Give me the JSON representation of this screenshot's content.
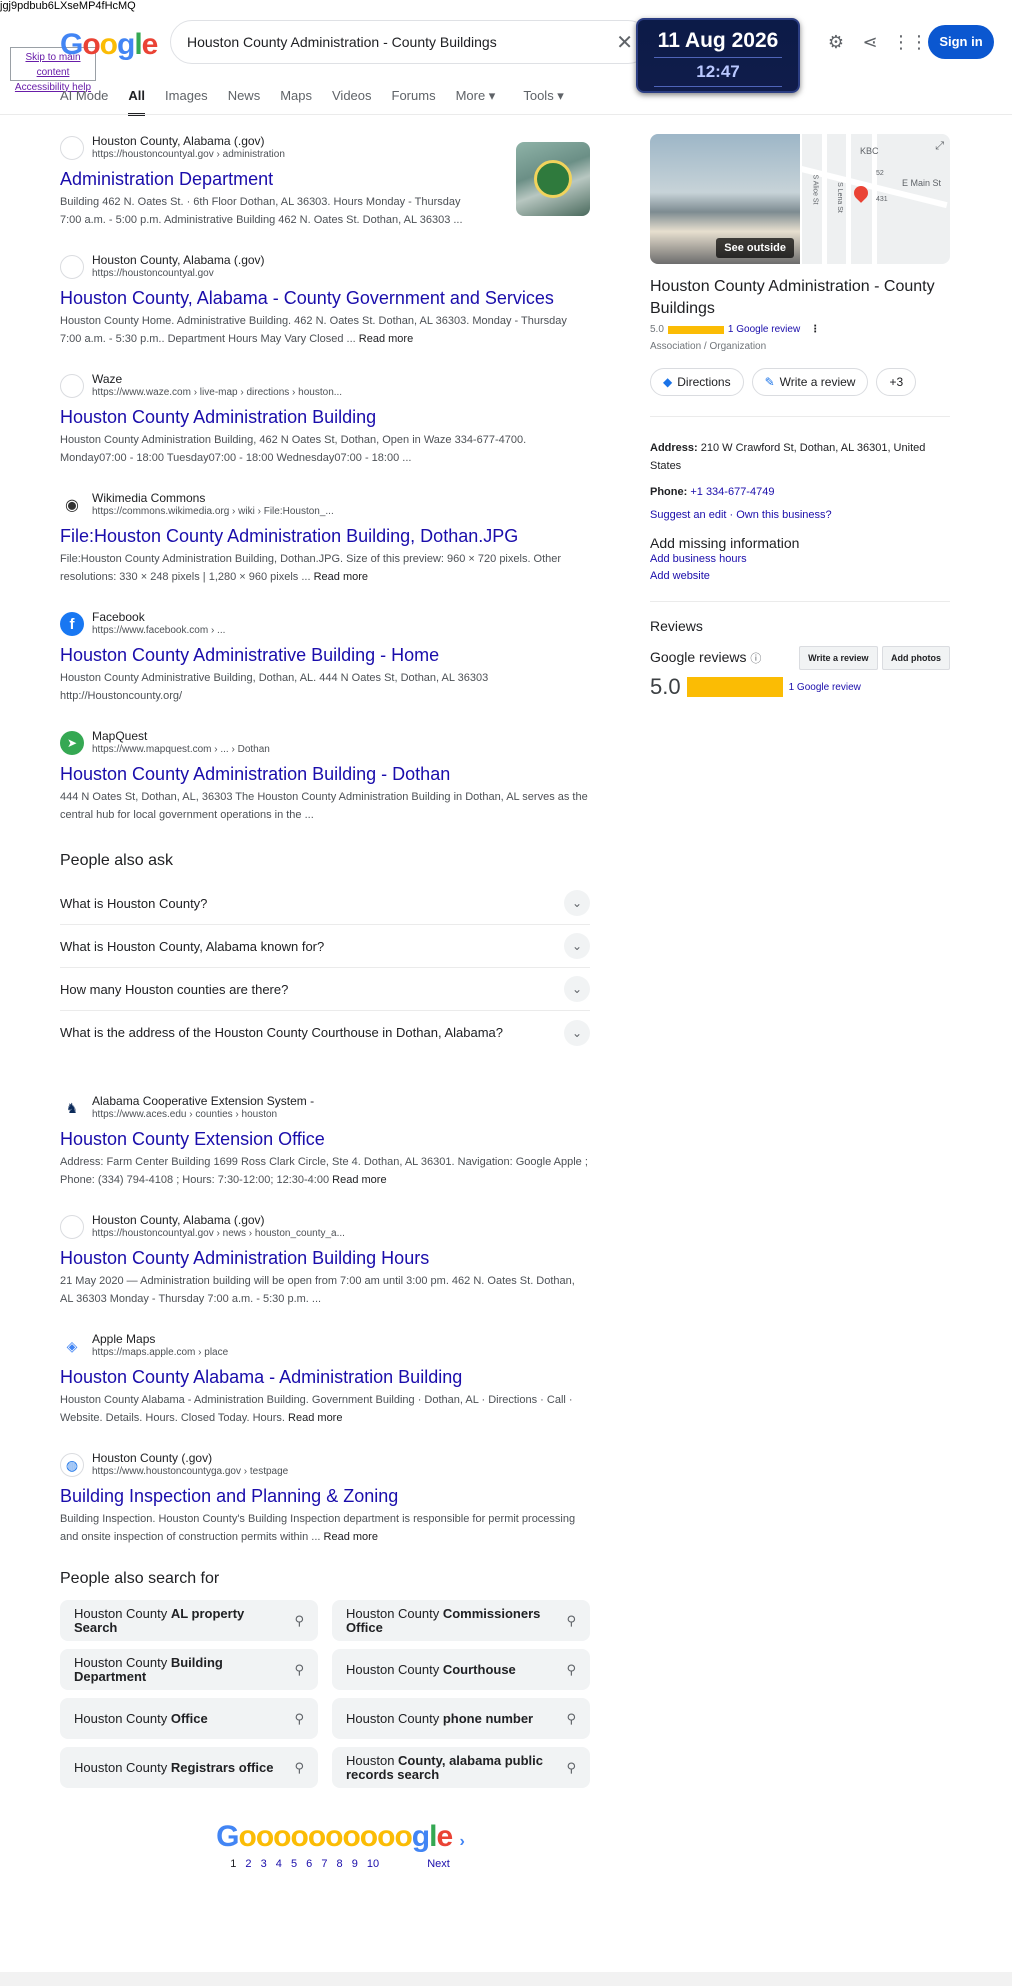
{
  "top_junk": "jgj9pdbub6LXseMP4fHcMQ",
  "skip_links": [
    "Skip to main content",
    "Accessibility help"
  ],
  "search": {
    "query": "Houston County Administration - County Buildings"
  },
  "clock": {
    "date": "11 Aug 2026",
    "time": "12:47"
  },
  "header": {
    "signin": "Sign in"
  },
  "tabs": [
    {
      "label": "AI Mode"
    },
    {
      "label": "All"
    },
    {
      "label": "Images"
    },
    {
      "label": "News"
    },
    {
      "label": "Maps"
    },
    {
      "label": "Videos"
    },
    {
      "label": "Forums"
    },
    {
      "label": "More ▾"
    },
    {
      "label": "Tools ▾"
    }
  ],
  "results": [
    {
      "site": "Houston County, Alabama (.gov)",
      "url": "https://houstoncountyal.gov › administration",
      "title": "Administration Department",
      "snippet": "Building 462 N. Oates St. · 6th Floor Dothan, AL 36303. Hours Monday - Thursday 7:00 a.m. - 5:00 p.m. Administrative Building 462 N. Oates St. Dothan, AL 36303 ..."
    },
    {
      "site": "Houston County, Alabama (.gov)",
      "url": "https://houstoncountyal.gov",
      "title": "Houston County, Alabama - County Government and Services",
      "snippet": "Houston County Home. Administrative Building. 462 N. Oates St. Dothan, AL 36303. Monday - Thursday 7:00 a.m. - 5:30 p.m.. Department Hours May Vary Closed ...",
      "readmore": "Read more"
    },
    {
      "site": "Waze",
      "url": "https://www.waze.com › live-map › directions › houston...",
      "title": "Houston County Administration Building",
      "snippet": "Houston County Administration Building, 462 N Oates St, Dothan, Open in Waze 334-677-4700. Monday07:00 - 18:00 Tuesday07:00 - 18:00 Wednesday07:00 - 18:00 ..."
    },
    {
      "site": "Wikimedia Commons",
      "url": "https://commons.wikimedia.org › wiki › File:Houston_...",
      "title": "File:Houston County Administration Building, Dothan.JPG",
      "snippet": "File:Houston County Administration Building, Dothan.JPG. Size of this preview: 960 × 720 pixels. Other resolutions: 330 × 248 pixels | 1,280 × 960 pixels ...",
      "readmore": "Read more"
    },
    {
      "site": "Facebook",
      "url": "https://www.facebook.com › ...",
      "title": "Houston County Administrative Building - Home",
      "snippet": "Houston County Administrative Building, Dothan, AL. 444 N Oates St, Dothan, AL 36303 http://Houstoncounty.org/"
    },
    {
      "site": "MapQuest",
      "url": "https://www.mapquest.com › ... › Dothan",
      "title": "Houston County Administration Building - Dothan",
      "snippet": "444 N Oates St, Dothan, AL, 36303 The Houston County Administration Building in Dothan, AL serves as the central hub for local government operations in the ..."
    }
  ],
  "paa": {
    "title": "People also ask",
    "items": [
      "What is Houston County?",
      "What is Houston County, Alabama known for?",
      "How many Houston counties are there?",
      "What is the address of the Houston County Courthouse in Dothan, Alabama?"
    ]
  },
  "results2": [
    {
      "site": "Alabama Cooperative Extension System -",
      "url": "https://www.aces.edu › counties › houston",
      "title": "Houston County Extension Office",
      "snippet": "Address: Farm Center Building 1699 Ross Clark Circle, Ste 4. Dothan, AL 36301. Navigation: Google Apple ; Phone: (334) 794-4108 ; Hours: 7:30-12:00; 12:30-4:00",
      "readmore": "Read more"
    },
    {
      "site": "Houston County, Alabama (.gov)",
      "url": "https://houstoncountyal.gov › news › houston_county_a...",
      "title": "Houston County Administration Building Hours",
      "snippet": "21 May 2020 — Administration building will be open from 7:00 am until 3:00 pm. 462 N. Oates St. Dothan, AL 36303 Monday - Thursday 7:00 a.m. - 5:30 p.m. ..."
    },
    {
      "site": "Apple Maps",
      "url": "https://maps.apple.com › place",
      "title": "Houston County Alabama - Administration Building",
      "snippet": "Houston County Alabama - Administration Building. Government Building · Dothan, AL · Directions · Call · Website. Details. Hours. Closed Today. Hours.",
      "readmore": "Read more"
    },
    {
      "site": "Houston County (.gov)",
      "url": "https://www.houstoncountyga.gov › testpage",
      "title": "Building Inspection and Planning & Zoning",
      "snippet": "Building Inspection. Houston County's Building Inspection department is responsible for permit processing and onsite inspection of construction permits within ...",
      "readmore": "Read more"
    }
  ],
  "pas": {
    "title": "People also search for",
    "items": [
      {
        "pre": "Houston County ",
        "bold": "AL property Search"
      },
      {
        "pre": "Houston County ",
        "bold": "Commissioners Office"
      },
      {
        "pre": "Houston County ",
        "bold": "Building Department"
      },
      {
        "pre": "Houston County ",
        "bold": "Courthouse"
      },
      {
        "pre": "Houston County ",
        "bold": "Office"
      },
      {
        "pre": "Houston County ",
        "bold": "phone number"
      },
      {
        "pre": "Houston County ",
        "bold": "Registrars office"
      },
      {
        "pre": "Houston ",
        "bold": "County, alabama public records search"
      }
    ]
  },
  "pager": {
    "pages": [
      "1",
      "2",
      "3",
      "4",
      "5",
      "6",
      "7",
      "8",
      "9",
      "10"
    ],
    "next": "Next"
  },
  "kp": {
    "see_outside": "See outside",
    "title": "Houston County Administration - County Buildings",
    "rating": "5.0",
    "review_link": "1 Google review",
    "category": "Association / Organization",
    "btn_directions": "Directions",
    "btn_write": "Write a review",
    "btn_more": "+3",
    "address_label": "Address:",
    "address": "210 W Crawford St, Dothan, AL 36301, United States",
    "phone_label": "Phone:",
    "phone": "+1 334-677-4749",
    "suggest": "Suggest an edit",
    "own": "Own this business?",
    "add_title": "Add missing information",
    "add_hours": "Add business hours",
    "add_website": "Add website",
    "reviews_title": "Reviews",
    "google_reviews": "Google reviews",
    "write_review_btn": "Write a review",
    "add_photos_btn": "Add photos",
    "score": "5.0",
    "score_count": "1 Google review",
    "map_labels": [
      "KBC",
      "E Main St",
      "S Alice St",
      "S Lena St",
      "52",
      "431"
    ]
  },
  "colors": {
    "link": "#1a0dab",
    "accent": "#0b57d0",
    "star": "#fbbc04"
  }
}
